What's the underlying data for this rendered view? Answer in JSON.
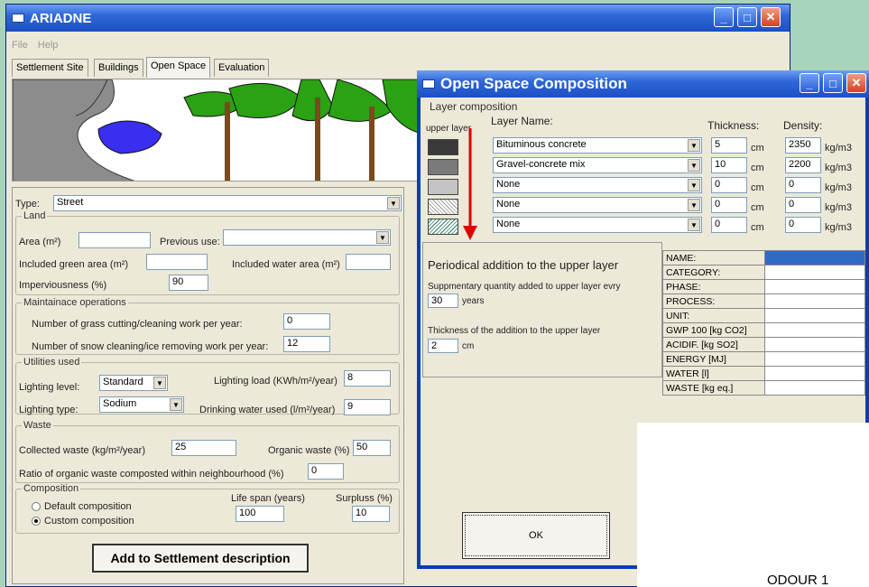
{
  "main_window": {
    "title": "ARIADNE",
    "menu": [
      "File",
      "Help"
    ],
    "tabs": [
      "Settlement Site",
      "Buildings",
      "Open Space",
      "Evaluation"
    ],
    "type_label": "Type:",
    "type_value": "Street",
    "land": {
      "caption": "Land",
      "area_label": "Area (m²)",
      "area_value": "",
      "prev_use_label": "Previous use:",
      "prev_use_value": "",
      "green_label": "Included green area (m²)",
      "green_value": "",
      "water_label": "Included water area (m²)",
      "water_value": "",
      "imperv_label": "Imperviousness (%)",
      "imperv_value": "90"
    },
    "maint": {
      "caption": "Maintainace operations",
      "grass_label": "Number of grass cutting/cleaning work per year:",
      "grass_value": "0",
      "snow_label": "Number of snow cleaning/ice removing work per year:",
      "snow_value": "12"
    },
    "util": {
      "caption": "Utilities used",
      "level_label": "Lighting level:",
      "level_value": "Standard",
      "load_label": "Lighting load (KWh/m²/year)",
      "load_value": "8",
      "type_label": "Lighting type:",
      "type_value": "Sodium",
      "water_label": "Drinking water used (l/m²/year)",
      "water_value": "9"
    },
    "waste": {
      "caption": "Waste",
      "collected_label": "Collected waste (kg/m²/year)",
      "collected_value": "25",
      "organic_label": "Organic waste (%)",
      "organic_value": "50",
      "ratio_label": "Ratio of organic waste composted within neighbourhood (%)",
      "ratio_value": "0"
    },
    "comp": {
      "caption": "Composition",
      "default_label": "Default composition",
      "custom_label": "Custom composition",
      "life_label": "Life span (years)",
      "life_value": "100",
      "surplus_label": "Surpluss (%)",
      "surplus_value": "10"
    },
    "add_button": "Add to Settlement description"
  },
  "dialog": {
    "title": "Open Space Composition",
    "layer_caption": "Layer composition",
    "upper_layer": "upper layer",
    "col_name": "Layer Name:",
    "col_thick": "Thickness:",
    "col_density": "Density:",
    "unit_cm": "cm",
    "unit_density": "kg/m3",
    "layers": [
      {
        "name": "Bituminous concrete",
        "thickness": "5",
        "density": "2350"
      },
      {
        "name": "Gravel-concrete mix",
        "thickness": "10",
        "density": "2200"
      },
      {
        "name": "None",
        "thickness": "0",
        "density": "0"
      },
      {
        "name": "None",
        "thickness": "0",
        "density": "0"
      },
      {
        "name": "None",
        "thickness": "0",
        "density": "0"
      }
    ],
    "periodic": {
      "caption": "Periodical addition to the upper layer",
      "qty_label": "Suppmentary quantity added to upper layer evry",
      "qty_value": "30",
      "qty_unit": "years",
      "thick_label": "Thickness of the addition to the upper layer",
      "thick_value": "2",
      "thick_unit": "cm"
    },
    "props": [
      "NAME:",
      "CATEGORY:",
      "PHASE:",
      "PROCESS:",
      "UNIT:",
      "GWP 100 [kg CO2]",
      "ACIDIF. [kg SO2]",
      "ENERGY [MJ]",
      "WATER [l]",
      "WASTE [kg eq.]"
    ],
    "ok_button": "OK"
  },
  "footer_text": "ODOUR 1",
  "colors": {
    "title_bar": "#2f67d7",
    "close_button": "#d2431f",
    "bg": "#a7d3bd",
    "arrow": "#e00000"
  }
}
